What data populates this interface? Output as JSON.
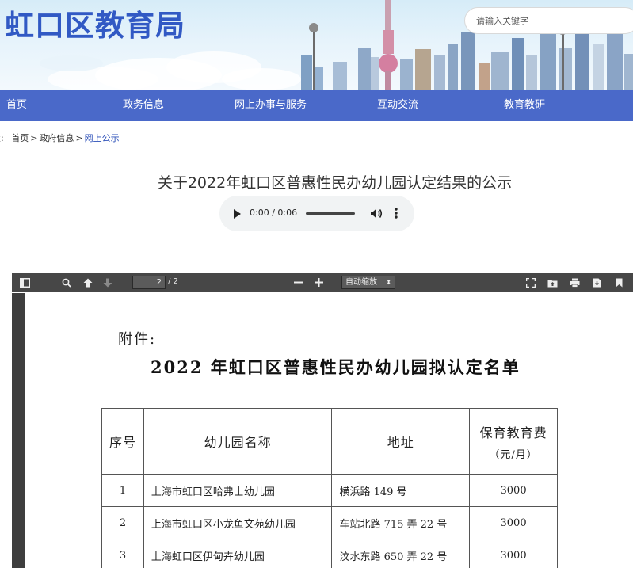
{
  "header": {
    "site_title": "虹口区教育局",
    "search_placeholder": "请输入关键字"
  },
  "nav": {
    "items": [
      "首页",
      "政务信息",
      "网上办事与服务",
      "互动交流",
      "教育教研"
    ]
  },
  "breadcrumb": {
    "prefix": "置:",
    "items": [
      "首页",
      "政府信息",
      "网上公示"
    ],
    "separator": ">"
  },
  "article": {
    "title": "关于2022年虹口区普惠性民办幼儿园认定结果的公示"
  },
  "audio": {
    "time": "0:00 / 0:06",
    "icons": [
      "play-icon",
      "volume-icon",
      "more-vert-icon"
    ]
  },
  "pdf_viewer": {
    "page_current": "2",
    "page_total": "/ 2",
    "zoom": "自动缩放"
  },
  "document": {
    "attachment_label": "附件:",
    "title": "2022 年虹口区普惠性民办幼儿园拟认定名单",
    "table": {
      "headers": {
        "index": "序号",
        "name": "幼儿园名称",
        "address": "地址",
        "fee": "保育教育费",
        "fee_unit": "（元/月）"
      },
      "rows": [
        {
          "index": "1",
          "name": "上海市虹口区哈弗士幼儿园",
          "address": "横浜路 149 号",
          "fee": "3000"
        },
        {
          "index": "2",
          "name": "上海市虹口区小龙鱼文苑幼儿园",
          "address": "车站北路 715 弄 22 号",
          "fee": "3000"
        },
        {
          "index": "3",
          "name": "上海虹口区伊甸卉幼儿园",
          "address": "汶水东路 650 弄 22 号",
          "fee": "3000"
        }
      ]
    }
  },
  "colors": {
    "brand_blue": "#3159c4",
    "nav_blue": "#4a69c9",
    "link_blue": "#2b4fb8",
    "pdf_toolbar": "#474747"
  }
}
